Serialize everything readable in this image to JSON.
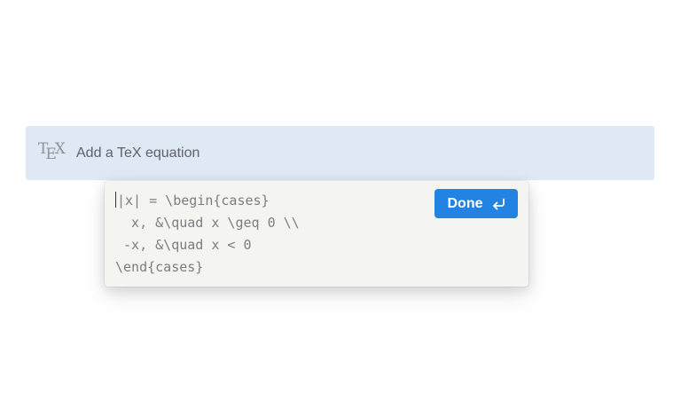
{
  "equation_block": {
    "logo_letters": [
      "T",
      "E",
      "X"
    ],
    "placeholder": "Add a TeX equation"
  },
  "editor": {
    "code_lines": [
      "|x| = \\begin{cases}",
      "  x, &\\quad x \\geq 0 \\\\",
      " -x, &\\quad x < 0",
      "\\end{cases}"
    ]
  },
  "done_button": {
    "label": "Done",
    "icon": "enter-icon"
  },
  "colors": {
    "block_background": "#dfe8f5",
    "popup_background": "#f4f4f1",
    "accent": "#2383e2"
  }
}
